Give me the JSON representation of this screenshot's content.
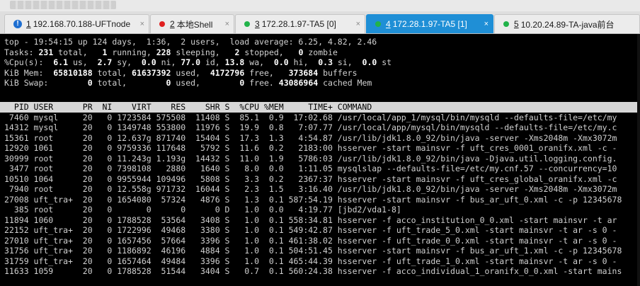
{
  "tabs": [
    {
      "num": "1",
      "label": "192.168.70.188-UFTnode",
      "close": "×",
      "status": "info",
      "color": "#1e6fd1"
    },
    {
      "num": "2",
      "label": "本地Shell",
      "close": "×",
      "status": "error",
      "color": "#e02020"
    },
    {
      "num": "3",
      "label": "172.28.1.97-TA5 [0]",
      "close": "×",
      "status": "ok",
      "color": "#22b34a"
    },
    {
      "num": "4",
      "label": "172.28.1.97-TA5 [1]",
      "close": "×",
      "status": "ok",
      "color": "#22b34a",
      "active": true
    },
    {
      "num": "5",
      "label": "10.20.24.89-TA-java前台",
      "close": "",
      "status": "ok",
      "color": "#22b34a"
    }
  ],
  "summary": {
    "line1": "top - 19:54:15 up 124 days,  1:36,  2 users,  load average: 6.25, 4.82, 2.46",
    "tasks": {
      "p0": "Tasks: ",
      "total": "231",
      "p1": " total,   ",
      "running": "1",
      "p2": " running, ",
      "sleeping": "228",
      "p3": " sleeping,   ",
      "stopped": "2",
      "p4": " stopped,   ",
      "zombie": "0",
      "p5": " zombie"
    },
    "cpu": {
      "p0": "%Cpu(s):  ",
      "us": "6.1",
      "p1": " us,  ",
      "sy": "2.7",
      "p2": " sy,  ",
      "ni": "0.0",
      "p3": " ni, ",
      "id": "77.0",
      "p4": " id, ",
      "wa": "13.8",
      "p5": " wa,  ",
      "hi": "0.0",
      "p6": " hi,  ",
      "si": "0.3",
      "p7": " si,  ",
      "st": "0.0",
      "p8": " st"
    },
    "mem": {
      "p0": "KiB Mem:  ",
      "total": "65810188",
      "p1": " total, ",
      "used": "61637392",
      "p2": " used,  ",
      "free": "4172796",
      "p3": " free,   ",
      "buffers": "373684",
      "p4": " buffers"
    },
    "swap": {
      "p0": "KiB Swap:        ",
      "total": "0",
      "p1": " total,        ",
      "used": "0",
      "p2": " used,        ",
      "free": "0",
      "p3": " free. ",
      "cached": "43086964",
      "p4": " cached Mem"
    }
  },
  "table": {
    "header": "  PID USER      PR  NI    VIRT    RES    SHR S  %CPU %MEM     TIME+ COMMAND",
    "rows": [
      " 7460 mysql     20   0 1723584 575508  11408 S  85.1  0.9  17:02.68 /usr/local/app_1/mysql/bin/mysqld --defaults-file=/etc/my",
      "14312 mysql     20   0 1349748 553800  11976 S  19.9  0.8   7:07.77 /usr/local/app/mysql/bin/mysqld --defaults-file=/etc/my.c",
      "15361 root      20   0 12.637g 871740  15404 S  17.3  1.3   4:54.87 /usr/lib/jdk1.8.0_92/bin/java -server -Xms2048m -Xmx3072m",
      "12920 1061      20   0 9759336 117648   5792 S  11.6  0.2   2183:00 hsserver -start mainsvr -f uft_cres_0001_oranifx.xml -c -",
      "30999 root      20   0 11.243g 1.193g  14432 S  11.0  1.9   5786:03 /usr/lib/jdk1.8.0_92/bin/java -Djava.util.logging.config.",
      " 3477 root      20   0 7398108   2880   1640 S   8.0  0.0   1:11.05 mysqlslap --defaults-file=/etc/my.cnf.57 --concurrency=10",
      "10510 1064      20   0 9955944 109496   5808 S   3.3  0.2   2367:37 hsserver -start mainsvr -f uft_cres_global_oranifx.xml -c",
      " 7940 root      20   0 12.558g 971732  16044 S   2.3  1.5   3:16.40 /usr/lib/jdk1.8.0_92/bin/java -server -Xms2048m -Xmx3072m",
      "27008 uft_tra+  20   0 1654080  57324   4876 S   1.3  0.1 587:54.19 hsserver -start mainsvr -f bus_ar_uft_0.xml -c -p 12345678",
      "  385 root      20   0       0      0      0 D   1.0  0.0   4:19.77 [jbd2/vda1-8]",
      "11894 1060      20   0 1788528  53564   3408 S   1.0  0.1 558:34.81 hsserver -f acco_institution_0_0.xml -start mainsvr -t ar",
      "22152 uft_tra+  20   0 1722996  49468   3380 S   1.0  0.1 549:42.87 hsserver -f uft_trade_5_0.xml -start mainsvr -t ar -s 0 -",
      "27010 uft_tra+  20   0 1657456  57664   3396 S   1.0  0.1 461:38.02 hsserver -f uft_trade_0_0.xml -start mainsvr -t ar -s 0 -",
      "31756 uft_tra+  20   0 1186892  46196   4884 S   1.0  0.1 504:51.45 hsserver -start mainsvr -f bus_ar_uft_1.xml -c -p 12345678",
      "31759 uft_tra+  20   0 1657464  49484   3396 S   1.0  0.1 465:44.39 hsserver -f uft_trade_1_0.xml -start mainsvr -t ar -s 0 -",
      "11633 1059      20   0 1788528  51544   3404 S   0.7  0.1 560:24.38 hsserver -f acco_individual_1_oranifx_0_0.xml -start mains"
    ]
  }
}
